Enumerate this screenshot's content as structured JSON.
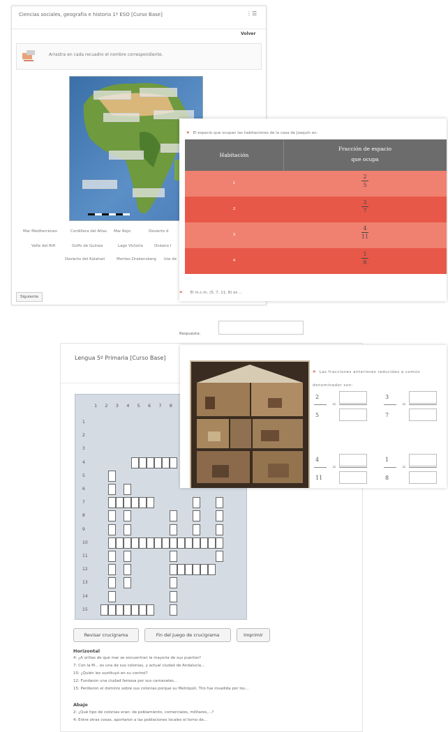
{
  "geo": {
    "title": "Ciencias sociales, geografía e historia 1º ESO [Curso Base]",
    "menu_icon": "menu-icon",
    "volver": "Volver",
    "instruction": "Arrastra en cada recuadro el nombre correspondiente.",
    "words_row1": [
      "Mar Mediterráneo",
      "Cordillera del Atlas",
      "Mar Rojo",
      "Desierto d"
    ],
    "words_row2": [
      "Valle del Rift",
      "Golfo de Guinea",
      "Lago Victoria",
      "Océano I"
    ],
    "words_row3": [
      "Desierto del Kalahari",
      "Montes Drakensberg",
      "Isla de"
    ],
    "next_button": "Siguiente"
  },
  "fractions": {
    "question": "El espacio que ocupan las habitaciones de la casa de Joaquín es:",
    "header_room": "Habitación",
    "header_fraction_l1": "Fracción de espacio",
    "header_fraction_l2": "que ocupa",
    "rows": [
      {
        "room": "1",
        "num": "2",
        "den": "5",
        "color": "#f08070"
      },
      {
        "room": "2",
        "num": "3",
        "den": "7",
        "color": "#e85848"
      },
      {
        "room": "3",
        "num": "4",
        "den": "11",
        "color": "#f08070"
      },
      {
        "room": "4",
        "num": "1",
        "den": "8",
        "color": "#e85848"
      }
    ],
    "mcm_text": "El m.c.m. (5, 7, 11, 8) es ..."
  },
  "answer": {
    "label": "Respuesta:",
    "value": ""
  },
  "dollhouse": {
    "instruction": "Las fracciones anteriores reducidas a común denominador son:",
    "fractions": [
      {
        "num": "2",
        "den": "5"
      },
      {
        "num": "3",
        "den": "7"
      },
      {
        "num": "4",
        "den": "11"
      },
      {
        "num": "1",
        "den": "8"
      }
    ],
    "equals": "="
  },
  "crossword": {
    "title": "Lengua 5º Primaria [Curso Base]",
    "column_numbers": "1 2 3 4 5 6 7 8 9 10",
    "row_numbers": [
      "1",
      "2",
      "3",
      "4",
      "5",
      "6",
      "7",
      "8",
      "9",
      "10",
      "11",
      "12",
      "13",
      "14",
      "15"
    ],
    "buttons": {
      "check": "Revisar crucigrama",
      "finish": "Fin del juego de crucigrama",
      "print": "Imprimir"
    },
    "horizontal_title": "Horizontal",
    "horizontal": [
      "4: ¿A orillas de qué mar se encuentran la mayoría de sus puertos?",
      "7: Con la M... es una de sus colonias, y actual ciudad de Andalucía...",
      "10: ¿Quién les sustituyó en su control?",
      "12: Fundaron una ciudad famosa por sus carnavales...",
      "15: Perdieron el dominio sobre sus colonias porque su Metrópoli, Tiro fue invadida por los..."
    ],
    "vertical_title": "Abajo",
    "vertical": [
      "2: ¿Qué tipo de colonias eran: de poblamiento, comerciales, militares,...?",
      "4: Entre otras cosas, aportaron a las poblaciones locales el torno de..."
    ]
  }
}
